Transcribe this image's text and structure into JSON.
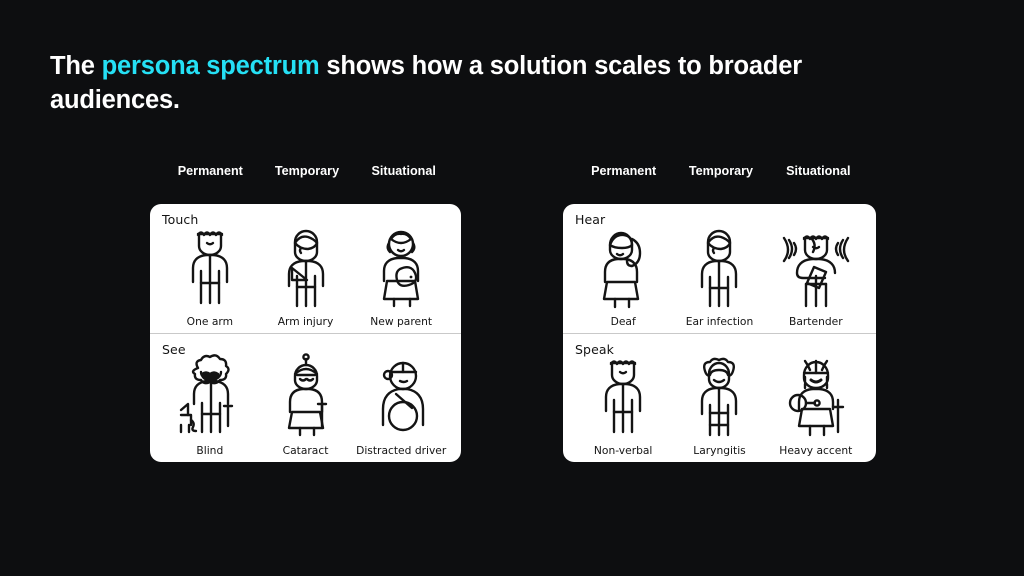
{
  "theme": {
    "background": "#0d0e10",
    "panel_background": "#ffffff",
    "title_color": "#ffffff",
    "accent_color": "#25e0f5",
    "ink": "#141414",
    "divider": "#c9c9c9"
  },
  "title": {
    "before": "The ",
    "accent": "persona spectrum",
    "after": " shows how a solution scales to broader audiences."
  },
  "columns": {
    "permanent": "Permanent",
    "temporary": "Temporary",
    "situational": "Situational"
  },
  "panels": [
    {
      "id": "touch-see",
      "rows": [
        {
          "label": "Touch",
          "cells": [
            {
              "label": "One arm",
              "icon": "person-one-arm-icon"
            },
            {
              "label": "Arm injury",
              "icon": "person-arm-sling-icon"
            },
            {
              "label": "New parent",
              "icon": "person-holding-baby-icon"
            }
          ]
        },
        {
          "label": "See",
          "cells": [
            {
              "label": "Blind",
              "icon": "person-guide-dog-icon"
            },
            {
              "label": "Cataract",
              "icon": "person-cataract-icon"
            },
            {
              "label": "Distracted driver",
              "icon": "person-driving-icon"
            }
          ]
        }
      ]
    },
    {
      "id": "hear-speak",
      "rows": [
        {
          "label": "Hear",
          "cells": [
            {
              "label": "Deaf",
              "icon": "person-deaf-icon"
            },
            {
              "label": "Ear infection",
              "icon": "person-ear-infection-icon"
            },
            {
              "label": "Bartender",
              "icon": "person-bartender-noise-icon"
            }
          ]
        },
        {
          "label": "Speak",
          "cells": [
            {
              "label": "Non-verbal",
              "icon": "person-non-verbal-icon"
            },
            {
              "label": "Laryngitis",
              "icon": "person-laryngitis-icon"
            },
            {
              "label": "Heavy accent",
              "icon": "person-heavy-accent-icon"
            }
          ]
        }
      ]
    }
  ]
}
